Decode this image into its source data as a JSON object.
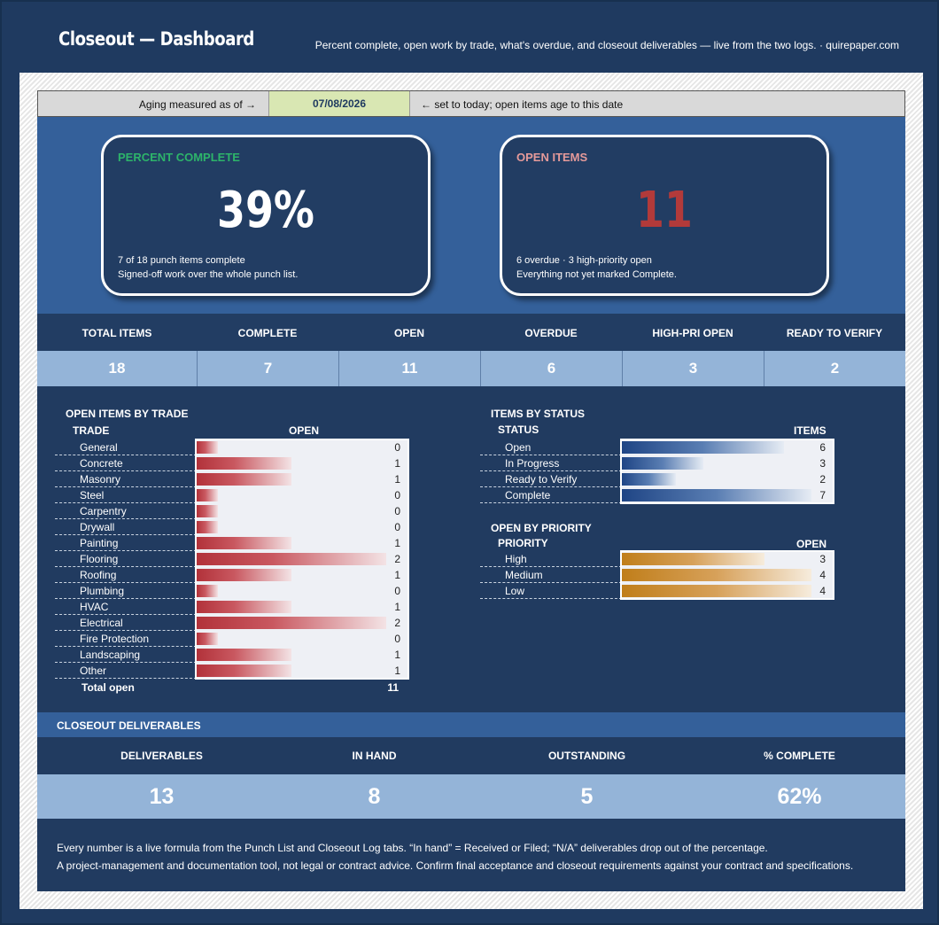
{
  "header": {
    "title": "Closeout — Dashboard",
    "subtitle": "Percent complete, open work by trade, what's overdue, and closeout deliverables — live from the two logs.  ·  quirepaper.com"
  },
  "asof": {
    "label": "Aging measured as of →",
    "date": "07/08/2026",
    "hint": "← set to today; open items age to this date"
  },
  "cards": {
    "percent": {
      "title": "PERCENT COMPLETE",
      "value": "39%",
      "line1": "7 of 18 punch items complete",
      "line2": "Signed-off work over the whole punch list.",
      "title_color": "#2db46a",
      "value_color": "#ffffff"
    },
    "open": {
      "title": "OPEN ITEMS",
      "value": "11",
      "line1": "6 overdue  ·  3 high-priority open",
      "line2": "Everything not yet marked Complete.",
      "title_color": "#e59a9a",
      "value_color": "#b23a3a"
    }
  },
  "kpis": {
    "labels": [
      "TOTAL ITEMS",
      "COMPLETE",
      "OPEN",
      "OVERDUE",
      "HIGH-PRI OPEN",
      "READY TO VERIFY"
    ],
    "values": [
      "18",
      "7",
      "11",
      "6",
      "3",
      "2"
    ]
  },
  "by_trade": {
    "title": "OPEN ITEMS BY TRADE",
    "col_trade": "TRADE",
    "col_open": "OPEN",
    "rows": [
      {
        "label": "General",
        "value": "0",
        "fill": 0
      },
      {
        "label": "Concrete",
        "value": "1",
        "fill": 0.5
      },
      {
        "label": "Masonry",
        "value": "1",
        "fill": 0.5
      },
      {
        "label": "Steel",
        "value": "0",
        "fill": 0
      },
      {
        "label": "Carpentry",
        "value": "0",
        "fill": 0
      },
      {
        "label": "Drywall",
        "value": "0",
        "fill": 0
      },
      {
        "label": "Painting",
        "value": "1",
        "fill": 0.5
      },
      {
        "label": "Flooring",
        "value": "2",
        "fill": 1
      },
      {
        "label": "Roofing",
        "value": "1",
        "fill": 0.5
      },
      {
        "label": "Plumbing",
        "value": "0",
        "fill": 0
      },
      {
        "label": "HVAC",
        "value": "1",
        "fill": 0.5
      },
      {
        "label": "Electrical",
        "value": "2",
        "fill": 1
      },
      {
        "label": "Fire Protection",
        "value": "0",
        "fill": 0
      },
      {
        "label": "Landscaping",
        "value": "1",
        "fill": 0.5
      },
      {
        "label": "Other",
        "value": "1",
        "fill": 0.5
      }
    ],
    "total_label": "Total open",
    "total_value": "11"
  },
  "by_status": {
    "title": "ITEMS BY STATUS",
    "col_label": "STATUS",
    "col_value": "ITEMS",
    "rows": [
      {
        "label": "Open",
        "value": "6",
        "fill": 0.857
      },
      {
        "label": "In Progress",
        "value": "3",
        "fill": 0.43
      },
      {
        "label": "Ready to Verify",
        "value": "2",
        "fill": 0.286
      },
      {
        "label": "Complete",
        "value": "7",
        "fill": 1
      }
    ]
  },
  "by_priority": {
    "title": "OPEN BY PRIORITY",
    "col_label": "PRIORITY",
    "col_value": "OPEN",
    "rows": [
      {
        "label": "High",
        "value": "3",
        "fill": 0.75
      },
      {
        "label": "Medium",
        "value": "4",
        "fill": 1
      },
      {
        "label": "Low",
        "value": "4",
        "fill": 1
      }
    ]
  },
  "deliverables": {
    "title": "CLOSEOUT DELIVERABLES",
    "labels": [
      "DELIVERABLES",
      "IN HAND",
      "OUTSTANDING",
      "% COMPLETE"
    ],
    "values": [
      "13",
      "8",
      "5",
      "62%"
    ]
  },
  "footer": {
    "line1": "Every number is a live formula from the Punch List and Closeout Log tabs.  “In hand” = Received or Filed; “N/A” deliverables drop out of the percentage.",
    "line2": "A project-management and documentation tool, not legal or contract advice.  Confirm final acceptance and closeout requirements against your contract and specifications."
  }
}
